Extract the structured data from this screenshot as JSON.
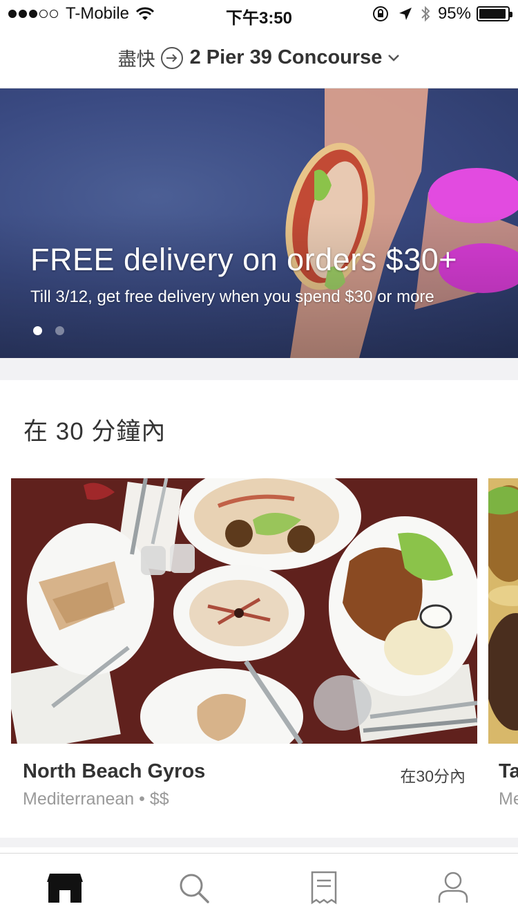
{
  "status_bar": {
    "carrier": "T-Mobile",
    "signal_bars_filled": 3,
    "signal_bars_total": 5,
    "time": "下午3:50",
    "battery_text": "95%",
    "battery_level": 0.95
  },
  "header": {
    "asap_label": "盡快",
    "address": "2 Pier 39 Concourse"
  },
  "banner": {
    "title": "FREE delivery on orders $30+",
    "subtitle": "Till 3/12, get free delivery when you spend $30 or more",
    "page_count": 2,
    "active_page": 1
  },
  "section": {
    "title": "在 30 分鐘內"
  },
  "restaurants": [
    {
      "name": "North Beach Gyros",
      "eta": "在30分內",
      "meta": "Mediterranean • $$"
    },
    {
      "name": "Ta",
      "meta": "Me"
    }
  ],
  "tab_bar": {
    "tabs": [
      {
        "icon": "storefront-icon",
        "active": true
      },
      {
        "icon": "search-icon",
        "active": false
      },
      {
        "icon": "receipt-icon",
        "active": false
      },
      {
        "icon": "profile-icon",
        "active": false
      }
    ]
  },
  "colors": {
    "text_primary": "#333333",
    "text_secondary": "#9a9a9a",
    "divider": "#f2f2f4",
    "tab_active": "#111111",
    "tab_inactive": "#888888"
  }
}
